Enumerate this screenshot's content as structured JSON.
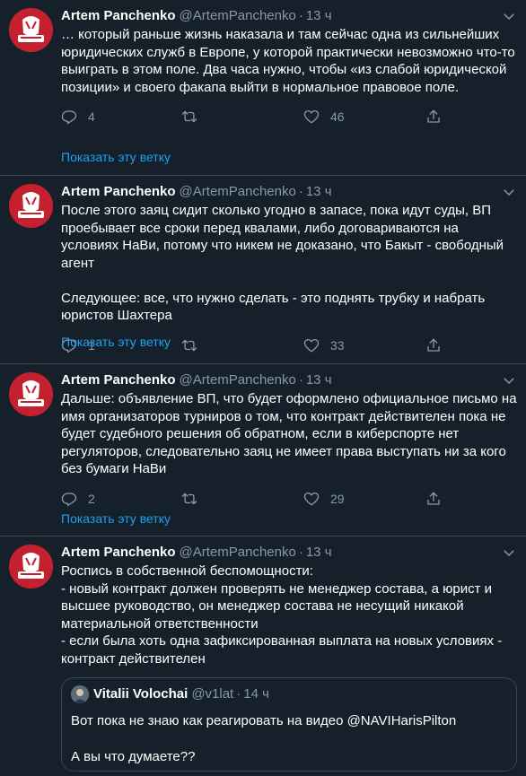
{
  "tweets": [
    {
      "author": "Artem Panchenko",
      "handle": "@ArtemPanchenko",
      "sep": "·",
      "time": "13 ч",
      "text": "… который раньше жизнь наказала и там сейчас одна из сильнейших юридических служб в Европе, у которой практически невозможно что-то выиграть в этом поле. Два часа нужно, чтобы «из слабой юридической позиции» и своего факапа выйти в нормальное правовое поле.",
      "replies": "4",
      "retweets": "",
      "likes": "46",
      "thread_link": "Показать эту ветку"
    },
    {
      "author": "Artem Panchenko",
      "handle": "@ArtemPanchenko",
      "sep": "·",
      "time": "13 ч",
      "text": "После этого заяц сидит сколько угодно в запасе, пока идут суды, ВП проебывает все сроки перед квалами, либо договариваются на условиях НаВи, потому что никем не доказано, что Бакыт - свободный агент\n\nСледующее: все, что нужно сделать - это поднять трубку и набрать юристов Шахтера",
      "replies": "1",
      "retweets": "",
      "likes": "33",
      "thread_link": "Показать эту ветку"
    },
    {
      "author": "Artem Panchenko",
      "handle": "@ArtemPanchenko",
      "sep": "·",
      "time": "13 ч",
      "text": "Дальше: объявление ВП, что будет оформлено официальное письмо на имя организаторов турниров о том, что контракт действителен пока не будет судебного решения об обратном, если в киберспорте нет регуляторов, следовательно заяц не имеет права выступать ни за кого без бумаги НаВи",
      "replies": "2",
      "retweets": "",
      "likes": "29",
      "thread_link": "Показать эту ветку"
    },
    {
      "author": "Artem Panchenko",
      "handle": "@ArtemPanchenko",
      "sep": "·",
      "time": "13 ч",
      "text": "Роспись в собственной беспомощности:\n- новый контракт должен проверять не менеджер состава, а юрист и высшее руководство, он менеджер состава не несущий никакой материальной ответственности\n- если была хоть одна зафиксированная выплата на новых условиях - контракт действителен",
      "quote": {
        "author": "Vitalii Volochai",
        "handle": "@v1lat",
        "sep": "·",
        "time": "14 ч",
        "text": "Вот пока не знаю как реагировать на видео @NAVIHarisPilton\n\nА вы что думаете??"
      }
    }
  ],
  "icons": {
    "reply": "reply-icon",
    "retweet": "retweet-icon",
    "like": "heart-icon",
    "share": "share-icon",
    "more": "chevron-down-icon"
  },
  "colors": {
    "background": "#15202b",
    "border": "#38444d",
    "secondary_text": "#8899a6",
    "link": "#1da1f2",
    "avatar_bg": "#c4202f"
  }
}
